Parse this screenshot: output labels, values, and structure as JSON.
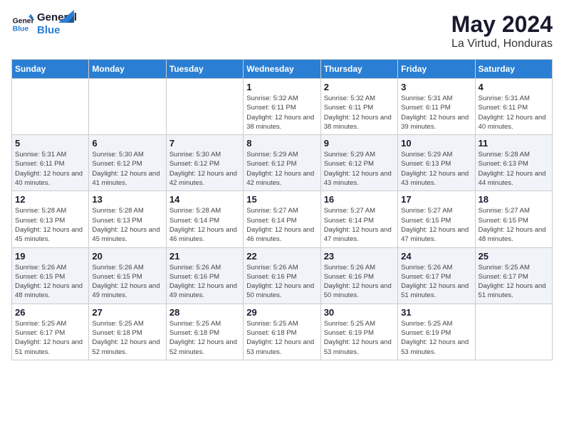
{
  "header": {
    "logo_line1": "General",
    "logo_line2": "Blue",
    "month": "May 2024",
    "location": "La Virtud, Honduras"
  },
  "weekdays": [
    "Sunday",
    "Monday",
    "Tuesday",
    "Wednesday",
    "Thursday",
    "Friday",
    "Saturday"
  ],
  "weeks": [
    [
      {
        "day": "",
        "info": ""
      },
      {
        "day": "",
        "info": ""
      },
      {
        "day": "",
        "info": ""
      },
      {
        "day": "1",
        "info": "Sunrise: 5:32 AM\nSunset: 6:11 PM\nDaylight: 12 hours\nand 38 minutes."
      },
      {
        "day": "2",
        "info": "Sunrise: 5:32 AM\nSunset: 6:11 PM\nDaylight: 12 hours\nand 38 minutes."
      },
      {
        "day": "3",
        "info": "Sunrise: 5:31 AM\nSunset: 6:11 PM\nDaylight: 12 hours\nand 39 minutes."
      },
      {
        "day": "4",
        "info": "Sunrise: 5:31 AM\nSunset: 6:11 PM\nDaylight: 12 hours\nand 40 minutes."
      }
    ],
    [
      {
        "day": "5",
        "info": "Sunrise: 5:31 AM\nSunset: 6:11 PM\nDaylight: 12 hours\nand 40 minutes."
      },
      {
        "day": "6",
        "info": "Sunrise: 5:30 AM\nSunset: 6:12 PM\nDaylight: 12 hours\nand 41 minutes."
      },
      {
        "day": "7",
        "info": "Sunrise: 5:30 AM\nSunset: 6:12 PM\nDaylight: 12 hours\nand 42 minutes."
      },
      {
        "day": "8",
        "info": "Sunrise: 5:29 AM\nSunset: 6:12 PM\nDaylight: 12 hours\nand 42 minutes."
      },
      {
        "day": "9",
        "info": "Sunrise: 5:29 AM\nSunset: 6:12 PM\nDaylight: 12 hours\nand 43 minutes."
      },
      {
        "day": "10",
        "info": "Sunrise: 5:29 AM\nSunset: 6:13 PM\nDaylight: 12 hours\nand 43 minutes."
      },
      {
        "day": "11",
        "info": "Sunrise: 5:28 AM\nSunset: 6:13 PM\nDaylight: 12 hours\nand 44 minutes."
      }
    ],
    [
      {
        "day": "12",
        "info": "Sunrise: 5:28 AM\nSunset: 6:13 PM\nDaylight: 12 hours\nand 45 minutes."
      },
      {
        "day": "13",
        "info": "Sunrise: 5:28 AM\nSunset: 6:13 PM\nDaylight: 12 hours\nand 45 minutes."
      },
      {
        "day": "14",
        "info": "Sunrise: 5:28 AM\nSunset: 6:14 PM\nDaylight: 12 hours\nand 46 minutes."
      },
      {
        "day": "15",
        "info": "Sunrise: 5:27 AM\nSunset: 6:14 PM\nDaylight: 12 hours\nand 46 minutes."
      },
      {
        "day": "16",
        "info": "Sunrise: 5:27 AM\nSunset: 6:14 PM\nDaylight: 12 hours\nand 47 minutes."
      },
      {
        "day": "17",
        "info": "Sunrise: 5:27 AM\nSunset: 6:15 PM\nDaylight: 12 hours\nand 47 minutes."
      },
      {
        "day": "18",
        "info": "Sunrise: 5:27 AM\nSunset: 6:15 PM\nDaylight: 12 hours\nand 48 minutes."
      }
    ],
    [
      {
        "day": "19",
        "info": "Sunrise: 5:26 AM\nSunset: 6:15 PM\nDaylight: 12 hours\nand 48 minutes."
      },
      {
        "day": "20",
        "info": "Sunrise: 5:26 AM\nSunset: 6:15 PM\nDaylight: 12 hours\nand 49 minutes."
      },
      {
        "day": "21",
        "info": "Sunrise: 5:26 AM\nSunset: 6:16 PM\nDaylight: 12 hours\nand 49 minutes."
      },
      {
        "day": "22",
        "info": "Sunrise: 5:26 AM\nSunset: 6:16 PM\nDaylight: 12 hours\nand 50 minutes."
      },
      {
        "day": "23",
        "info": "Sunrise: 5:26 AM\nSunset: 6:16 PM\nDaylight: 12 hours\nand 50 minutes."
      },
      {
        "day": "24",
        "info": "Sunrise: 5:26 AM\nSunset: 6:17 PM\nDaylight: 12 hours\nand 51 minutes."
      },
      {
        "day": "25",
        "info": "Sunrise: 5:25 AM\nSunset: 6:17 PM\nDaylight: 12 hours\nand 51 minutes."
      }
    ],
    [
      {
        "day": "26",
        "info": "Sunrise: 5:25 AM\nSunset: 6:17 PM\nDaylight: 12 hours\nand 51 minutes."
      },
      {
        "day": "27",
        "info": "Sunrise: 5:25 AM\nSunset: 6:18 PM\nDaylight: 12 hours\nand 52 minutes."
      },
      {
        "day": "28",
        "info": "Sunrise: 5:25 AM\nSunset: 6:18 PM\nDaylight: 12 hours\nand 52 minutes."
      },
      {
        "day": "29",
        "info": "Sunrise: 5:25 AM\nSunset: 6:18 PM\nDaylight: 12 hours\nand 53 minutes."
      },
      {
        "day": "30",
        "info": "Sunrise: 5:25 AM\nSunset: 6:19 PM\nDaylight: 12 hours\nand 53 minutes."
      },
      {
        "day": "31",
        "info": "Sunrise: 5:25 AM\nSunset: 6:19 PM\nDaylight: 12 hours\nand 53 minutes."
      },
      {
        "day": "",
        "info": ""
      }
    ]
  ]
}
